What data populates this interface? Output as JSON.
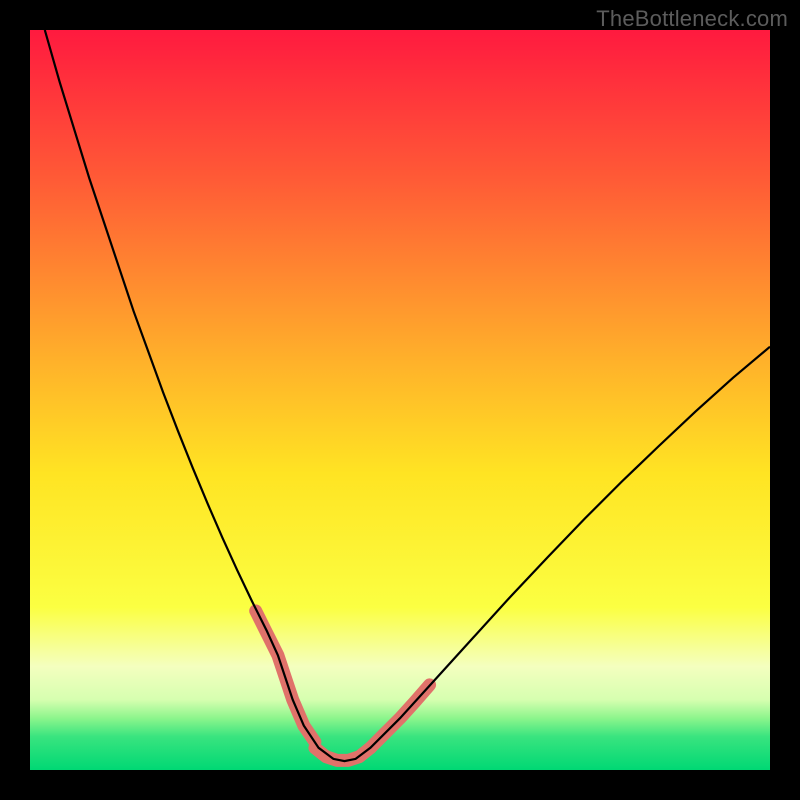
{
  "watermark": "TheBottleneck.com",
  "chart_data": {
    "type": "line",
    "title": "",
    "xlabel": "",
    "ylabel": "",
    "xlim": [
      0,
      100
    ],
    "ylim": [
      0,
      100
    ],
    "grid": false,
    "legend": false,
    "gradient_stops": [
      {
        "offset": 0.0,
        "color": "#ff1a3f"
      },
      {
        "offset": 0.2,
        "color": "#ff5a36"
      },
      {
        "offset": 0.45,
        "color": "#ffb22a"
      },
      {
        "offset": 0.6,
        "color": "#ffe423"
      },
      {
        "offset": 0.78,
        "color": "#fbff42"
      },
      {
        "offset": 0.86,
        "color": "#f4ffbf"
      },
      {
        "offset": 0.905,
        "color": "#d6ffb0"
      },
      {
        "offset": 0.93,
        "color": "#8cf58c"
      },
      {
        "offset": 0.955,
        "color": "#39e47f"
      },
      {
        "offset": 1.0,
        "color": "#00d874"
      }
    ],
    "series": [
      {
        "name": "curve",
        "color": "#000000",
        "width": 2.2,
        "x": [
          2,
          4,
          6,
          8,
          10,
          12,
          14,
          16,
          18,
          20,
          22,
          24,
          26,
          28,
          30,
          32,
          33.5,
          34.5,
          35.5,
          37,
          39,
          41,
          42.5,
          44,
          46,
          50,
          55,
          60,
          65,
          70,
          75,
          80,
          85,
          90,
          95,
          100
        ],
        "y": [
          100,
          93,
          86.5,
          80,
          74,
          68,
          62,
          56.5,
          51,
          45.8,
          40.8,
          36,
          31.4,
          27,
          22.8,
          18.8,
          15.5,
          12.5,
          9.5,
          6.0,
          3.0,
          1.5,
          1.2,
          1.5,
          3.0,
          7.0,
          12.5,
          18.0,
          23.5,
          28.8,
          34.0,
          39.0,
          43.8,
          48.5,
          53.0,
          57.2
        ]
      }
    ],
    "salmon_segments": [
      {
        "name": "left-marker",
        "color": "#e0726a",
        "width": 13,
        "x": [
          30.5,
          32,
          33.5,
          34.5,
          35.5,
          37,
          38.5
        ],
        "y": [
          21.5,
          18.5,
          15.5,
          12.5,
          9.5,
          6.0,
          3.8
        ]
      },
      {
        "name": "bottom-marker",
        "color": "#e0726a",
        "width": 13,
        "x": [
          38.5,
          40,
          41.5,
          43,
          44.5,
          46
        ],
        "y": [
          3.0,
          1.8,
          1.3,
          1.3,
          1.8,
          3.0
        ]
      },
      {
        "name": "right-marker",
        "color": "#e0726a",
        "width": 13,
        "x": [
          46,
          48,
          50,
          52,
          54
        ],
        "y": [
          3.0,
          5.0,
          7.0,
          9.2,
          11.5
        ]
      }
    ]
  }
}
